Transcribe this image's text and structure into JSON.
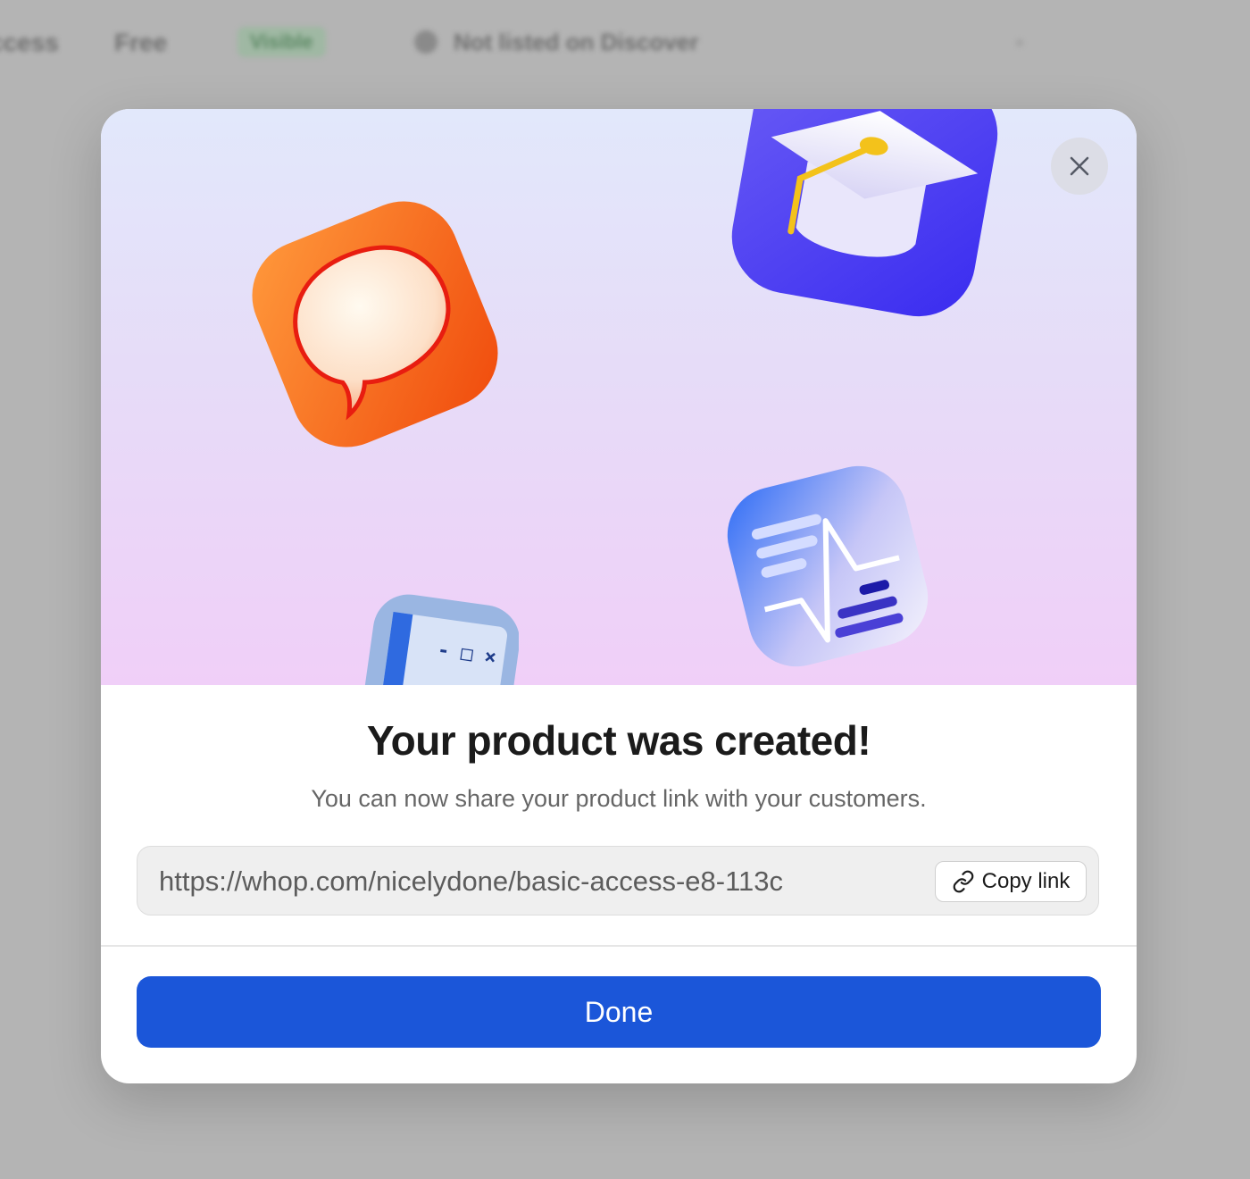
{
  "background": {
    "items": [
      "ccess",
      "Free",
      "Visible",
      "Not listed on Discover"
    ]
  },
  "modal": {
    "close_icon": "close-icon",
    "title": "Your product was created!",
    "subtitle": "You can now share your product link with your customers.",
    "link": {
      "url": "https://whop.com/nicelydone/basic-access-e8-113c",
      "copy_label": "Copy link",
      "copy_icon": "link-icon"
    },
    "done_label": "Done"
  },
  "colors": {
    "primary": "#1b56d9",
    "chat_icon": "#f26a1d",
    "course_icon": "#4a3cf0",
    "hero_top": "#e2e8fb",
    "hero_bottom": "#f0cff8"
  }
}
